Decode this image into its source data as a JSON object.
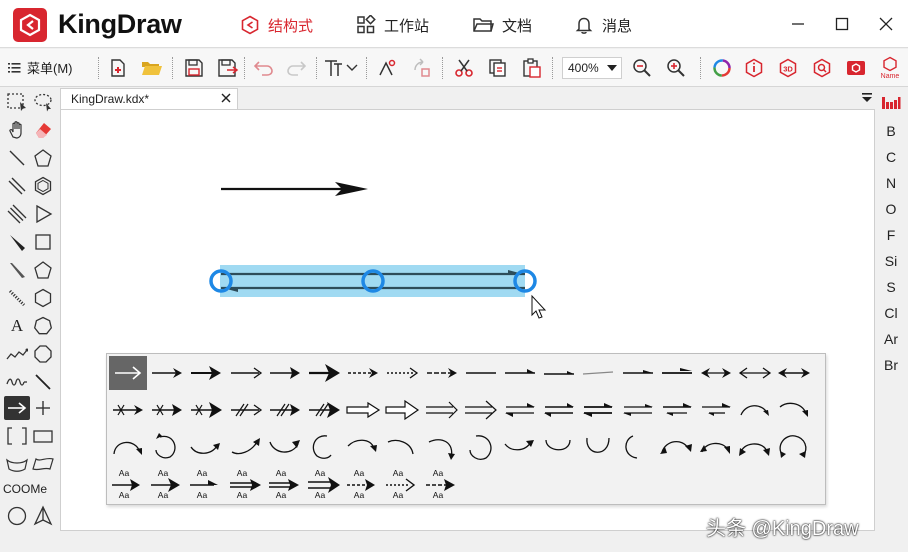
{
  "app": {
    "name": "KingDraw"
  },
  "nav": {
    "tabs": [
      {
        "label": "结构式",
        "icon": "structure-icon"
      },
      {
        "label": "工作站",
        "icon": "workstation-icon"
      },
      {
        "label": "文档",
        "icon": "folder-icon"
      },
      {
        "label": "消息",
        "icon": "bell-icon"
      }
    ],
    "active": "结构式"
  },
  "toolbar": {
    "menu_label": "菜单(M)",
    "zoom": "400%"
  },
  "document": {
    "tab_title": "KingDraw.kdx*"
  },
  "left_tools": {
    "text_tool": "A",
    "coome_label": "COOMe"
  },
  "elements": [
    "B",
    "C",
    "N",
    "O",
    "F",
    "Si",
    "S",
    "Cl",
    "Ar",
    "Br"
  ],
  "palette": {
    "text_sample": "Aa"
  },
  "colors": {
    "brand": "#d8262f",
    "selection": "#8fd3f0",
    "handle": "#1e88e5"
  },
  "watermark": "头条 @KingDraw"
}
